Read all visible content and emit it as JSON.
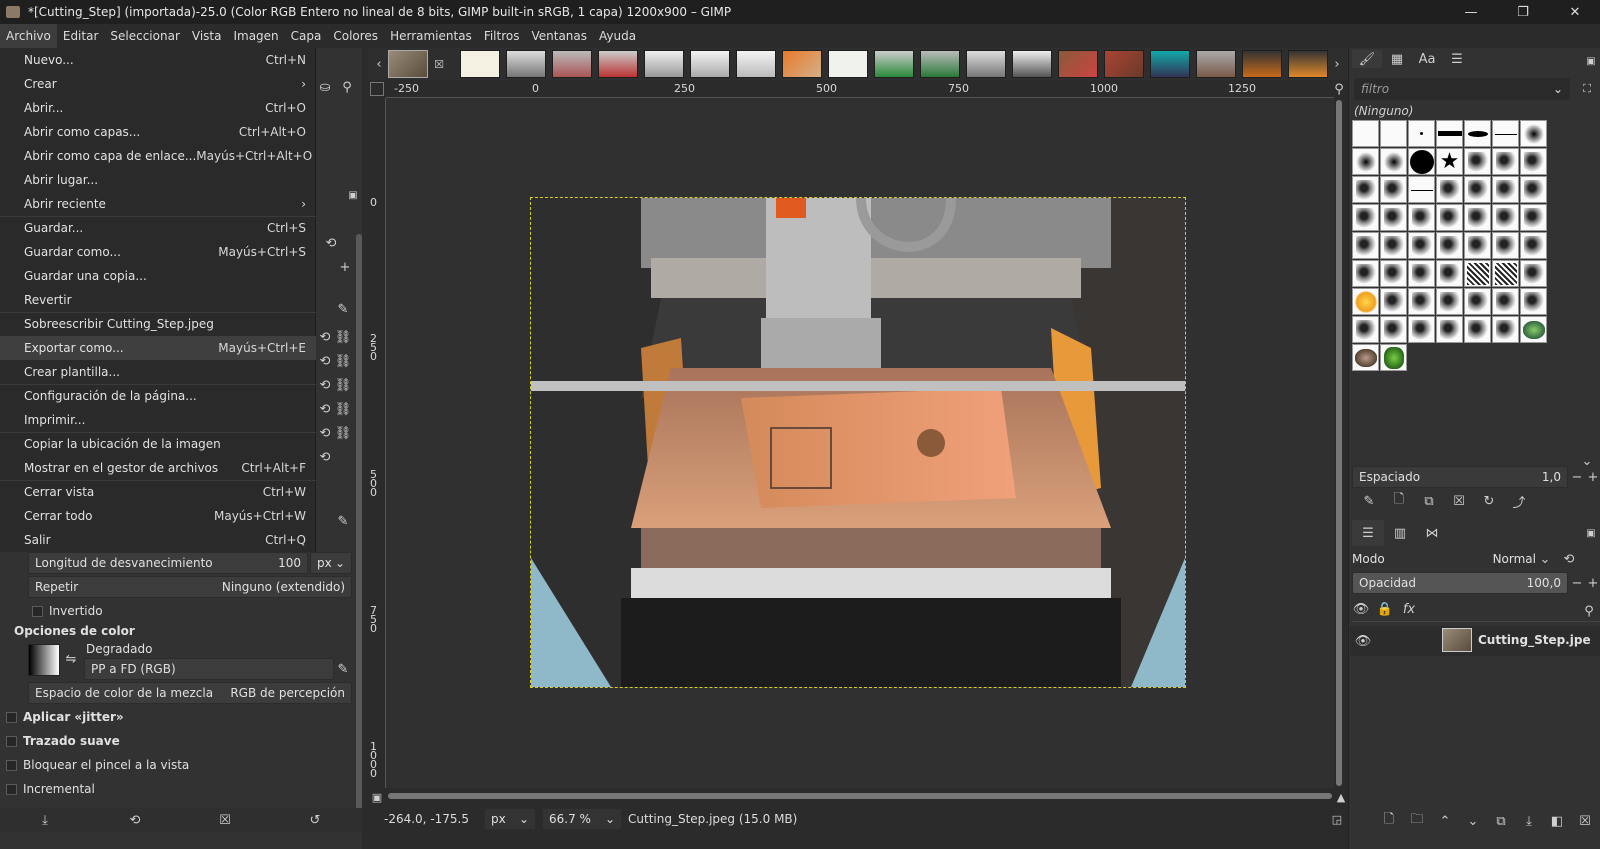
{
  "window": {
    "title": "*[Cutting_Step] (importada)-25.0 (Color RGB Entero no lineal de 8 bits, GIMP built-in sRGB, 1 capa) 1200x900 – GIMP",
    "controls": {
      "minimize": "—",
      "restore": "❐",
      "close": "✕"
    }
  },
  "menubar": [
    "Archivo",
    "Editar",
    "Seleccionar",
    "Vista",
    "Imagen",
    "Capa",
    "Colores",
    "Herramientas",
    "Filtros",
    "Ventanas",
    "Ayuda"
  ],
  "file_menu": {
    "items": [
      {
        "label": "Nuevo...",
        "shortcut": "Ctrl+N"
      },
      {
        "label": "Crear",
        "shortcut": "›"
      },
      {
        "label": "Abrir...",
        "shortcut": "Ctrl+O"
      },
      {
        "label": "Abrir como capas...",
        "shortcut": "Ctrl+Alt+O"
      },
      {
        "label": "Abrir como capa de enlace...",
        "shortcut": "Mayús+Ctrl+Alt+O"
      },
      {
        "label": "Abrir lugar...",
        "shortcut": ""
      },
      {
        "label": "Abrir reciente",
        "shortcut": "›"
      },
      {
        "label": "Guardar...",
        "shortcut": "Ctrl+S"
      },
      {
        "label": "Guardar como...",
        "shortcut": "Mayús+Ctrl+S"
      },
      {
        "label": "Guardar una copia...",
        "shortcut": ""
      },
      {
        "label": "Revertir",
        "shortcut": ""
      },
      {
        "label": "Sobreescribir Cutting_Step.jpeg",
        "shortcut": ""
      },
      {
        "label": "Exportar como...",
        "shortcut": "Mayús+Ctrl+E"
      },
      {
        "label": "Crear plantilla...",
        "shortcut": ""
      },
      {
        "label": "Configuración de la página...",
        "shortcut": ""
      },
      {
        "label": "Imprimir...",
        "shortcut": ""
      },
      {
        "label": "Copiar la ubicación de la imagen",
        "shortcut": ""
      },
      {
        "label": "Mostrar en el gestor de archivos",
        "shortcut": "Ctrl+Alt+F"
      },
      {
        "label": "Cerrar vista",
        "shortcut": "Ctrl+W"
      },
      {
        "label": "Cerrar todo",
        "shortcut": "Mayús+Ctrl+W"
      },
      {
        "label": "Salir",
        "shortcut": "Ctrl+Q"
      }
    ]
  },
  "tool_options": {
    "fade_length_label": "Longitud de desvanecimiento",
    "fade_length_value": "100",
    "fade_unit": "px",
    "repeat_label": "Repetir",
    "repeat_value": "Ninguno (extendido)",
    "inverted_label": "Invertido",
    "color_options_label": "Opciones de color",
    "gradient_label": "Degradado",
    "gradient_value": "PP a FD (RGB)",
    "blend_space_label": "Espacio de color de la mezcla",
    "blend_space_value": "RGB de percepción",
    "jitter_label": "Aplicar «jitter»",
    "smooth_label": "Trazado suave",
    "lock_brush_label": "Bloquear el pincel a la vista",
    "incremental_label": "Incremental"
  },
  "rulers": {
    "top": [
      "-250",
      "0",
      "250",
      "500",
      "750",
      "1000",
      "1250"
    ],
    "left": [
      "0",
      "250",
      "500",
      "750",
      "1000"
    ]
  },
  "statusbar": {
    "coords": "-264.0, -175.5",
    "unit": "px",
    "zoom": "66.7 %",
    "file_info": "Cutting_Step.jpeg (15.0 MB)"
  },
  "brushes_panel": {
    "filter_placeholder": "filtro",
    "selected": "(Ninguno)",
    "spacing_label": "Espaciado",
    "spacing_value": "1,0"
  },
  "layers_panel": {
    "mode_label": "Modo",
    "mode_value": "Normal",
    "opacity_label": "Opacidad",
    "opacity_value": "100,0",
    "layer_name": "Cutting_Step.jpe"
  },
  "colors": {
    "accent": "#e87a2a",
    "selection": "#d8d020"
  }
}
